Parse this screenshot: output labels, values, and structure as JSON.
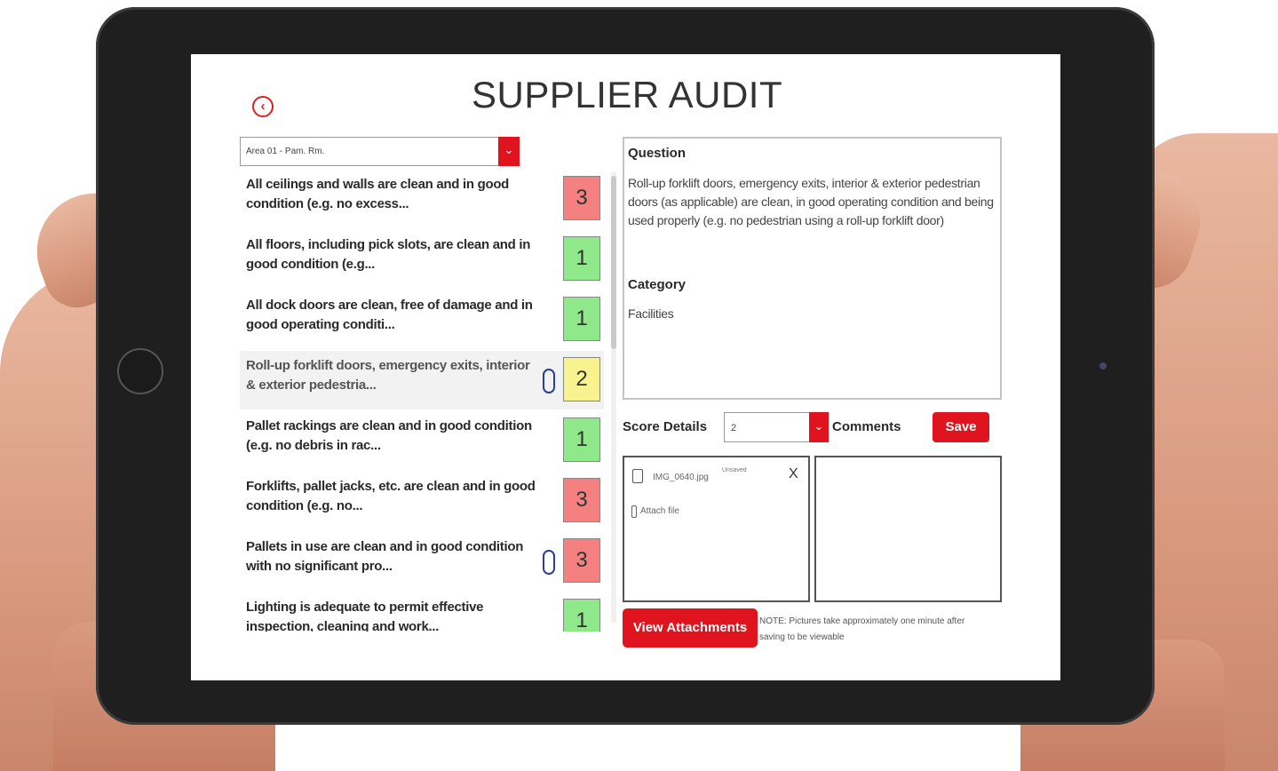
{
  "title": "SUPPLIER AUDIT",
  "area_dropdown": {
    "value": "Area 01 - Pam. Rm.",
    "arrow_icon": "chevron-down-icon"
  },
  "questions": [
    {
      "text": "All ceilings and walls are clean and in good condition (e.g. no excess...",
      "score": "3",
      "attachment": false,
      "selected": false
    },
    {
      "text": "All floors, including pick slots, are clean and in good condition (e.g...",
      "score": "1",
      "attachment": false,
      "selected": false
    },
    {
      "text": "All dock doors are clean, free of damage and in good operating conditi...",
      "score": "1",
      "attachment": false,
      "selected": false
    },
    {
      "text": "Roll-up forklift doors, emergency exits, interior & exterior pedestria...",
      "score": "2",
      "attachment": true,
      "selected": true
    },
    {
      "text": "Pallet rackings are clean and in good condition (e.g. no debris in rac...",
      "score": "1",
      "attachment": false,
      "selected": false
    },
    {
      "text": "Forklifts, pallet jacks, etc. are clean and in good condition (e.g. no...",
      "score": "3",
      "attachment": false,
      "selected": false
    },
    {
      "text": "Pallets in use are clean and in good condition with no significant pro...",
      "score": "3",
      "attachment": true,
      "selected": false
    },
    {
      "text": "Lighting is adequate to permit effective inspection, cleaning and work...",
      "score": "1",
      "attachment": false,
      "selected": false
    }
  ],
  "detail": {
    "question_label": "Question",
    "question_text": "Roll-up forklift doors, emergency exits, interior & exterior pedestrian doors (as applicable) are clean, in good operating condition and being used properly (e.g. no pedestrian using a roll-up forklift door)",
    "category_label": "Category",
    "category_value": "Facilities"
  },
  "score_details": {
    "label": "Score Details",
    "value": "2"
  },
  "comments_label": "Comments",
  "save_label": "Save",
  "attachments": {
    "file_name": "IMG_0640.jpg",
    "file_status": "Unsaved",
    "remove_label": "X",
    "attach_label": "Attach file"
  },
  "view_attachments_label": "View Attachments",
  "note": "NOTE: Pictures take approximately one minute after saving to be viewable",
  "colors": {
    "accent": "#e0141e",
    "score_3": "#f4807f",
    "score_2": "#f8f38e",
    "score_1": "#8fe98a"
  }
}
